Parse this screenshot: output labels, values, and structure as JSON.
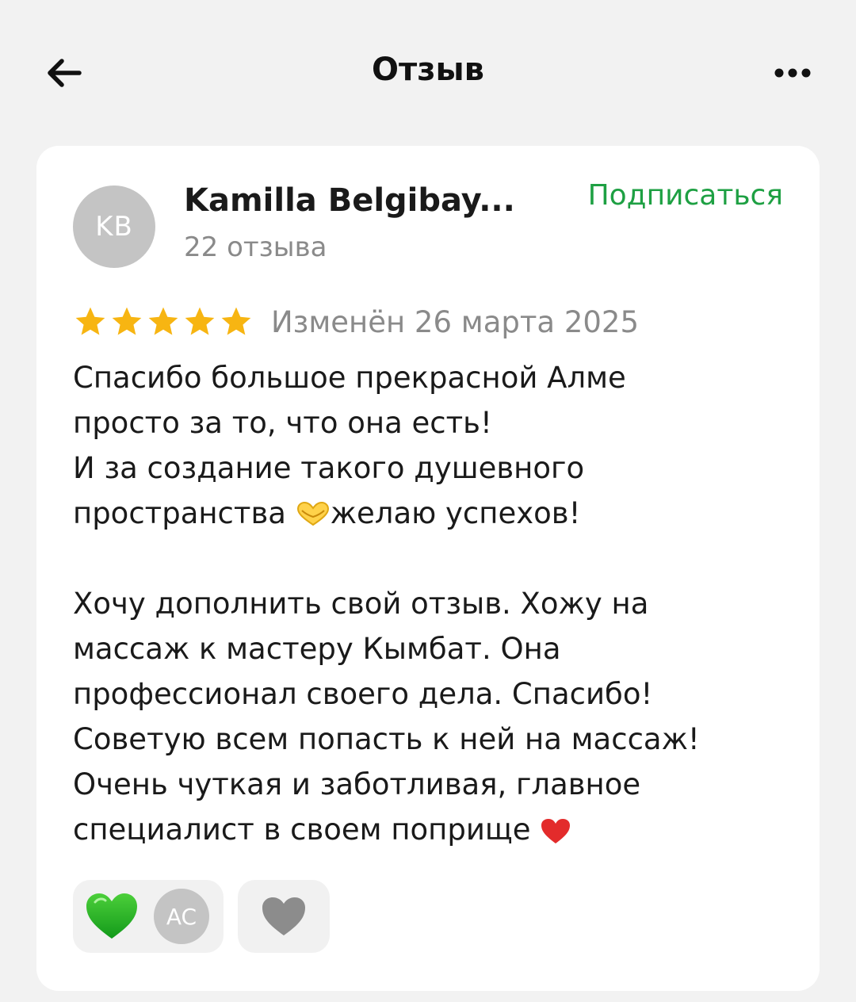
{
  "header": {
    "title": "Отзыв",
    "back_icon": "arrow-left-icon",
    "more_icon": "more-horizontal-icon"
  },
  "review": {
    "author": {
      "initials": "KB",
      "name": "Kamilla Belgibay...",
      "review_count": "22 отзыва"
    },
    "subscribe_label": "Подписаться",
    "rating": 5,
    "rating_max": 5,
    "edited_date": "Изменён 26 марта 2025",
    "paragraph1": {
      "line1": "Спасибо большое прекрасной Алме",
      "line2": "просто за то, что она есть!",
      "line3": "И за создание такого душевного",
      "line4_before": "пространства ",
      "line4_after": "желаю успехов!"
    },
    "paragraph2": {
      "line1": "Хочу дополнить свой отзыв. Хожу на",
      "line2": "массаж к мастеру Кымбат. Она",
      "line3": "профессионал своего дела. Спасибо!",
      "line4": "Советую всем попасть к ней на массаж!",
      "line5": "Очень чуткая и заботливая, главное",
      "line6": "специалист в своем поприще "
    },
    "reactions": {
      "green_heart_icon": "green-heart-icon",
      "reactor_initials": "AC",
      "grey_heart_icon": "grey-heart-icon"
    }
  },
  "colors": {
    "accent_green": "#1ea043",
    "star": "#f7b512",
    "background": "#f2f2f2",
    "card": "#ffffff",
    "muted_text": "#8a8a8a"
  }
}
